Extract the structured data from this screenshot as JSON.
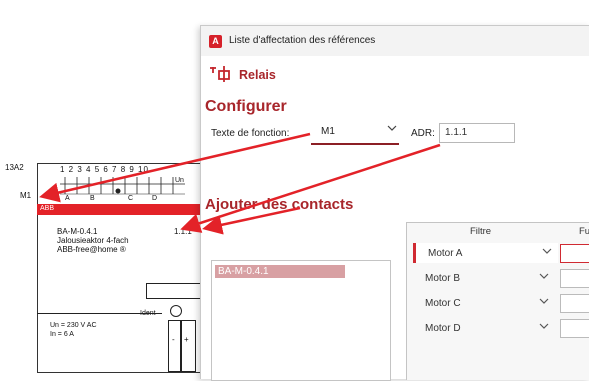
{
  "schematic": {
    "id_label": "13A2",
    "name_label": "M1",
    "terminal_numbers": "1 2 3 4 5 6 7 8 9 10",
    "un_label": "Un",
    "channel_labels": [
      "A",
      "B",
      "C",
      "D"
    ],
    "brand_tag": "ABB",
    "reference": "BA-M-0.4.1",
    "address": "1.1.1",
    "line2": "Jalousieaktor 4-fach",
    "line3": "ABB-free@home ®",
    "ident_label": "Ident",
    "voltage": "Un = 230 V AC",
    "current": "In = 6 A",
    "minus": "-",
    "plus": "+"
  },
  "dialog": {
    "title": "Liste d'affectation des références",
    "section_icon": "relay-icon",
    "section_label": "Relais",
    "configure_heading": "Configurer",
    "function_text_label": "Texte de fonction:",
    "function_text_value": "M1",
    "adr_label": "ADR:",
    "adr_value": "1.1.1",
    "add_contacts_heading": "Ajouter des contacts",
    "list_items": [
      "BA-M-0.4.1"
    ],
    "grid": {
      "col_filter": "Filtre",
      "col_fu": "Fu",
      "rows": [
        "Motor A",
        "Motor B",
        "Motor C",
        "Motor D"
      ]
    }
  },
  "colors": {
    "accent": "#a8262b",
    "brand_red": "#e32228"
  }
}
